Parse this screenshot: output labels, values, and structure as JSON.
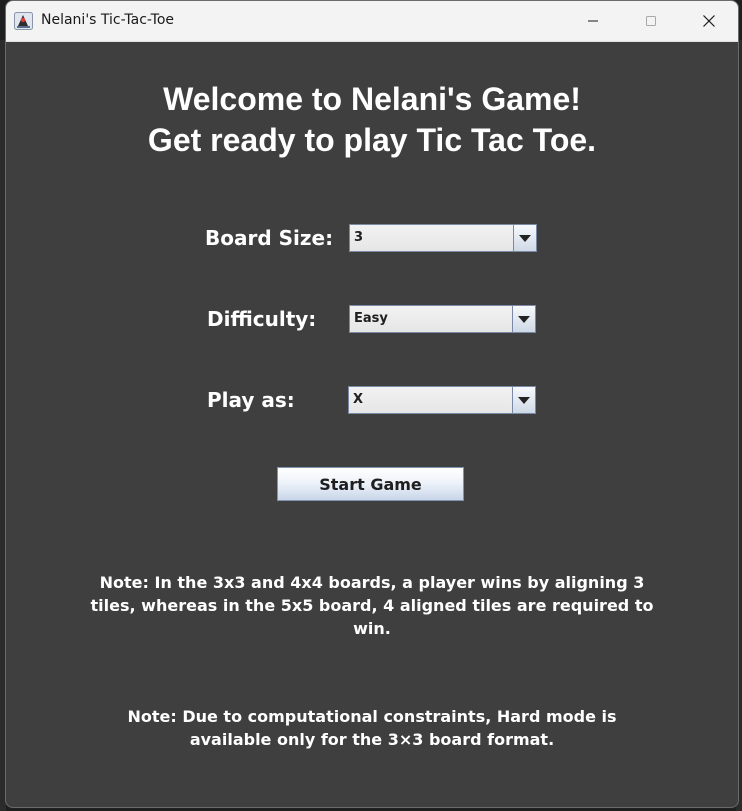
{
  "window": {
    "title": "Nelani's Tic-Tac-Toe",
    "app_icon": "java-duke-icon",
    "controls": [
      "minimize-icon",
      "maximize-icon",
      "close-icon"
    ]
  },
  "header": {
    "line1": "Welcome to Nelani's Game!",
    "line2": "Get ready to play Tic Tac Toe."
  },
  "form": {
    "board_size": {
      "label": "Board Size:",
      "value": "3"
    },
    "difficulty": {
      "label": "Difficulty:",
      "value": "Easy"
    },
    "play_as": {
      "label": "Play as:",
      "value": "X"
    }
  },
  "start_button": {
    "label": "Start Game"
  },
  "notes": {
    "note1": "Note: In the 3x3 and 4x4 boards, a player wins by aligning 3 tiles, whereas in the 5x5 board, 4 aligned tiles are required to win.",
    "note2": "Note: Due to computational constraints, Hard mode is available only for the 3×3 board format."
  },
  "colors": {
    "window_bg": "#3f3f3f",
    "titlebar_bg": "#f3f3f3",
    "text": "#ffffff",
    "button_border": "#8093b0"
  }
}
